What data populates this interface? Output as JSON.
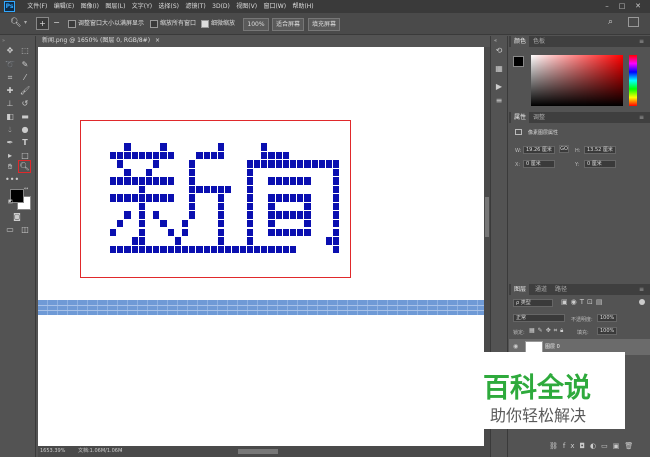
{
  "app": {
    "logo": "Ps"
  },
  "menu": [
    "文件(F)",
    "编辑(E)",
    "图像(I)",
    "图层(L)",
    "文字(Y)",
    "选择(S)",
    "滤镜(T)",
    "3D(D)",
    "视图(V)",
    "窗口(W)",
    "帮助(H)"
  ],
  "options": {
    "resize_windows": "调整窗口大小以满屏显示",
    "zoom_all": "缩放所有窗口",
    "scrubby_zoom": "细微缩放",
    "zoom_level": "100%",
    "fit_screen": "适合屏幕",
    "fill_screen": "填充屏幕"
  },
  "document": {
    "tab_title": "新闻.png @ 1650% (图层 0, RGB/8#)",
    "close": "×"
  },
  "status": {
    "zoom": "1653.39%",
    "doc": "文档:1.06M/1.06M"
  },
  "color_panel": {
    "tabs": [
      "颜色",
      "色板"
    ]
  },
  "properties_panel": {
    "tabs": [
      "属性",
      "调整"
    ],
    "title": "像素图层属性",
    "w_label": "W:",
    "w_value": "19.26 厘米",
    "h_label": "H:",
    "h_value": "13.52 厘米",
    "x_label": "X:",
    "x_value": "0 厘米",
    "y_label": "Y:",
    "y_value": "0 厘米",
    "link": "GO"
  },
  "layers_panel": {
    "tabs": [
      "图层",
      "通道",
      "路径"
    ],
    "filter": "ρ 类型",
    "blend_mode": "正常",
    "opacity_label": "不透明度:",
    "opacity": "100%",
    "lock_label": "锁定:",
    "fill_label": "填充:",
    "fill": "100%",
    "layer_name": "图层 0"
  },
  "watermark": {
    "title": "百科全说",
    "subtitle": "助你轻松解决"
  },
  "colors": {
    "pixel_blue": "#0a0fb0",
    "selection_red": "#e0292b",
    "band_blue": "#6f9ad6",
    "watermark_green": "#2eaa3c"
  }
}
